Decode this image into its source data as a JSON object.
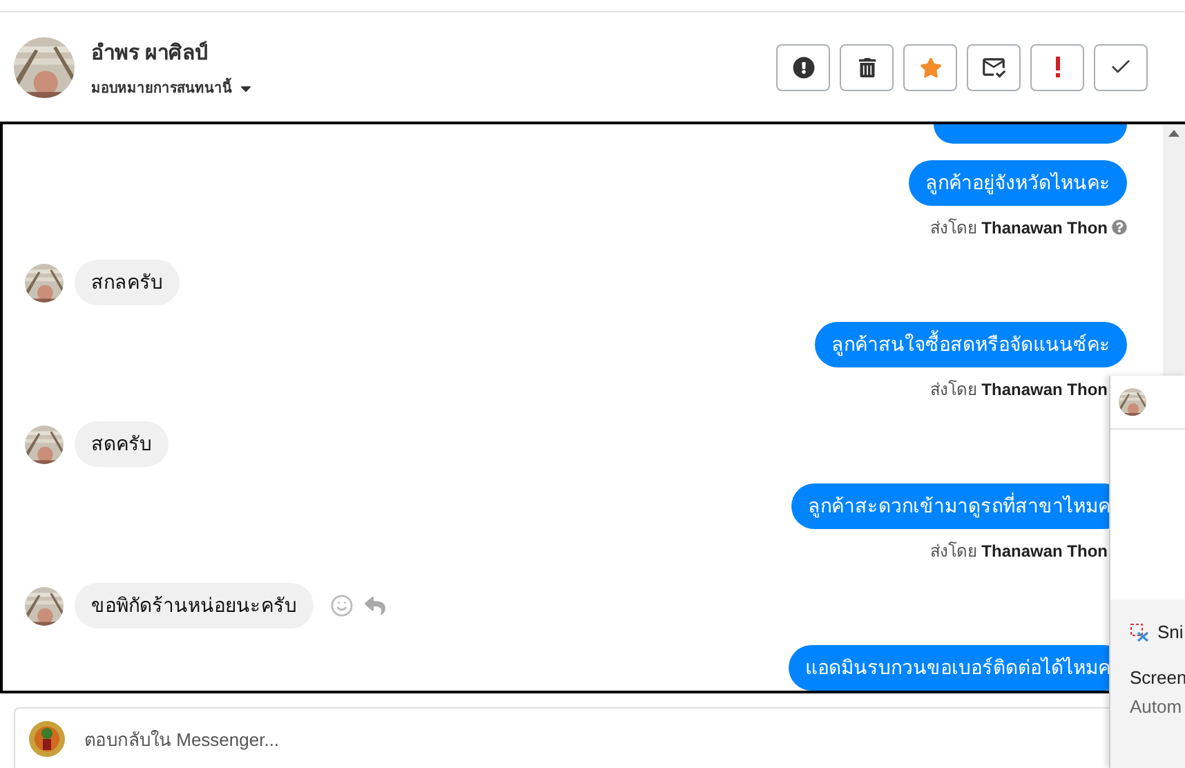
{
  "header": {
    "name": "อำพร ผาศิลป์",
    "subtitle": "มอบหมายการสนทนานี้"
  },
  "actions": [
    {
      "kind": "alert"
    },
    {
      "kind": "delete"
    },
    {
      "kind": "star"
    },
    {
      "kind": "mail"
    },
    {
      "kind": "important"
    },
    {
      "kind": "done"
    }
  ],
  "messages": [
    {
      "kind": "cut"
    },
    {
      "kind": "outgoing",
      "text": "ลูกค้าอยู่จังหวัดไหนคะ",
      "sender_prefix": "ส่งโดย",
      "sender": "Thanawan Thon",
      "help": true
    },
    {
      "kind": "incoming",
      "text": "สกลครับ"
    },
    {
      "kind": "outgoing",
      "text": "ลูกค้าสนใจซื้อสดหรือจัดแนนซ์คะ",
      "sender_prefix": "ส่งโดย",
      "sender": "Thanawan Thon"
    },
    {
      "kind": "incoming",
      "text": "สดครับ"
    },
    {
      "kind": "outgoing",
      "text": "ลูกค้าสะดวกเข้ามาดูรถที่สาขาไหมค",
      "sender_prefix": "ส่งโดย",
      "sender": "Thanawan Thon"
    },
    {
      "kind": "incoming",
      "text": "ขอพิกัดร้านหน่อยนะครับ",
      "hovered": true
    },
    {
      "kind": "outgoing",
      "text": "แอดมินรบกวนขอเบอร์ติดต่อได้ไหมค"
    }
  ],
  "reply": {
    "placeholder": "ตอบกลับใน Messenger..."
  },
  "popup": {
    "app": "Sni",
    "lines": [
      "Screen",
      "Autom"
    ]
  }
}
